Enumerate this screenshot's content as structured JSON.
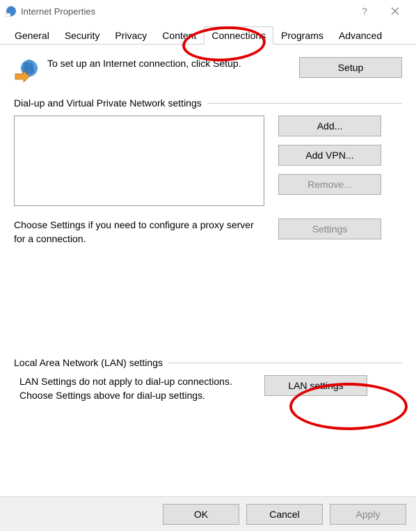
{
  "titlebar": {
    "title": "Internet Properties"
  },
  "tabs": {
    "items": [
      {
        "label": "General"
      },
      {
        "label": "Security"
      },
      {
        "label": "Privacy"
      },
      {
        "label": "Content"
      },
      {
        "label": "Connections"
      },
      {
        "label": "Programs"
      },
      {
        "label": "Advanced"
      }
    ],
    "activeIndex": 4
  },
  "setup": {
    "text": "To set up an Internet connection, click Setup.",
    "button": "Setup"
  },
  "dialup": {
    "header": "Dial-up and Virtual Private Network settings",
    "buttons": {
      "add": "Add...",
      "addVpn": "Add VPN...",
      "remove": "Remove...",
      "settings": "Settings"
    },
    "settingsText": "Choose Settings if you need to configure a proxy server for a connection."
  },
  "lan": {
    "header": "Local Area Network (LAN) settings",
    "text": "LAN Settings do not apply to dial-up connections. Choose Settings above for dial-up settings.",
    "button": "LAN settings"
  },
  "bottom": {
    "ok": "OK",
    "cancel": "Cancel",
    "apply": "Apply"
  }
}
